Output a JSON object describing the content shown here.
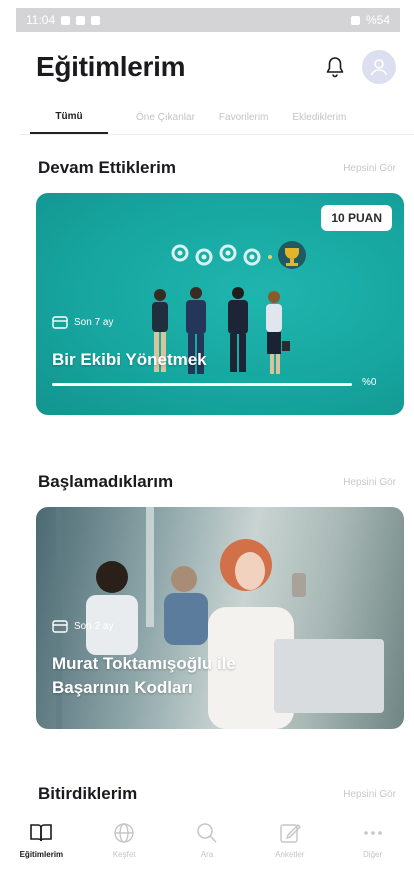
{
  "status_bar": {
    "time": "11:04",
    "battery": "%54"
  },
  "header": {
    "title": "Eğitimlerim"
  },
  "tabs": [
    {
      "label": "Tümü"
    },
    {
      "label": "Öne Çıkanlar"
    },
    {
      "label": "Favorilerim"
    },
    {
      "label": "Eklediklerim"
    }
  ],
  "sections": {
    "ongoing": {
      "title": "Devam Ettiklerim",
      "see_all": "Hepsini Gör"
    },
    "not_started": {
      "title": "Başlamadıklarım",
      "see_all": "Hepsini Gör"
    },
    "completed": {
      "title": "Bitirdiklerim",
      "see_all": "Hepsini Gör"
    }
  },
  "cards": {
    "ongoing": {
      "badge": "10 PUAN",
      "meta": "Son 7 ay",
      "title": "Bir Ekibi Yönetmek",
      "progress_label": "%0",
      "progress": 0,
      "accent": "#17a6a0"
    },
    "not_started": {
      "meta": "Son 2 ay",
      "title_line1": "Murat Toktamışoğlu ile",
      "title_line2": "Başarının Kodları"
    }
  },
  "tab_bar": [
    {
      "label": "Eğitimlerim",
      "icon": "book-icon"
    },
    {
      "label": "Keşfet",
      "icon": "globe-icon"
    },
    {
      "label": "Ara",
      "icon": "search-icon"
    },
    {
      "label": "Anketler",
      "icon": "edit-icon"
    },
    {
      "label": "Diğer",
      "icon": "more-icon"
    }
  ]
}
